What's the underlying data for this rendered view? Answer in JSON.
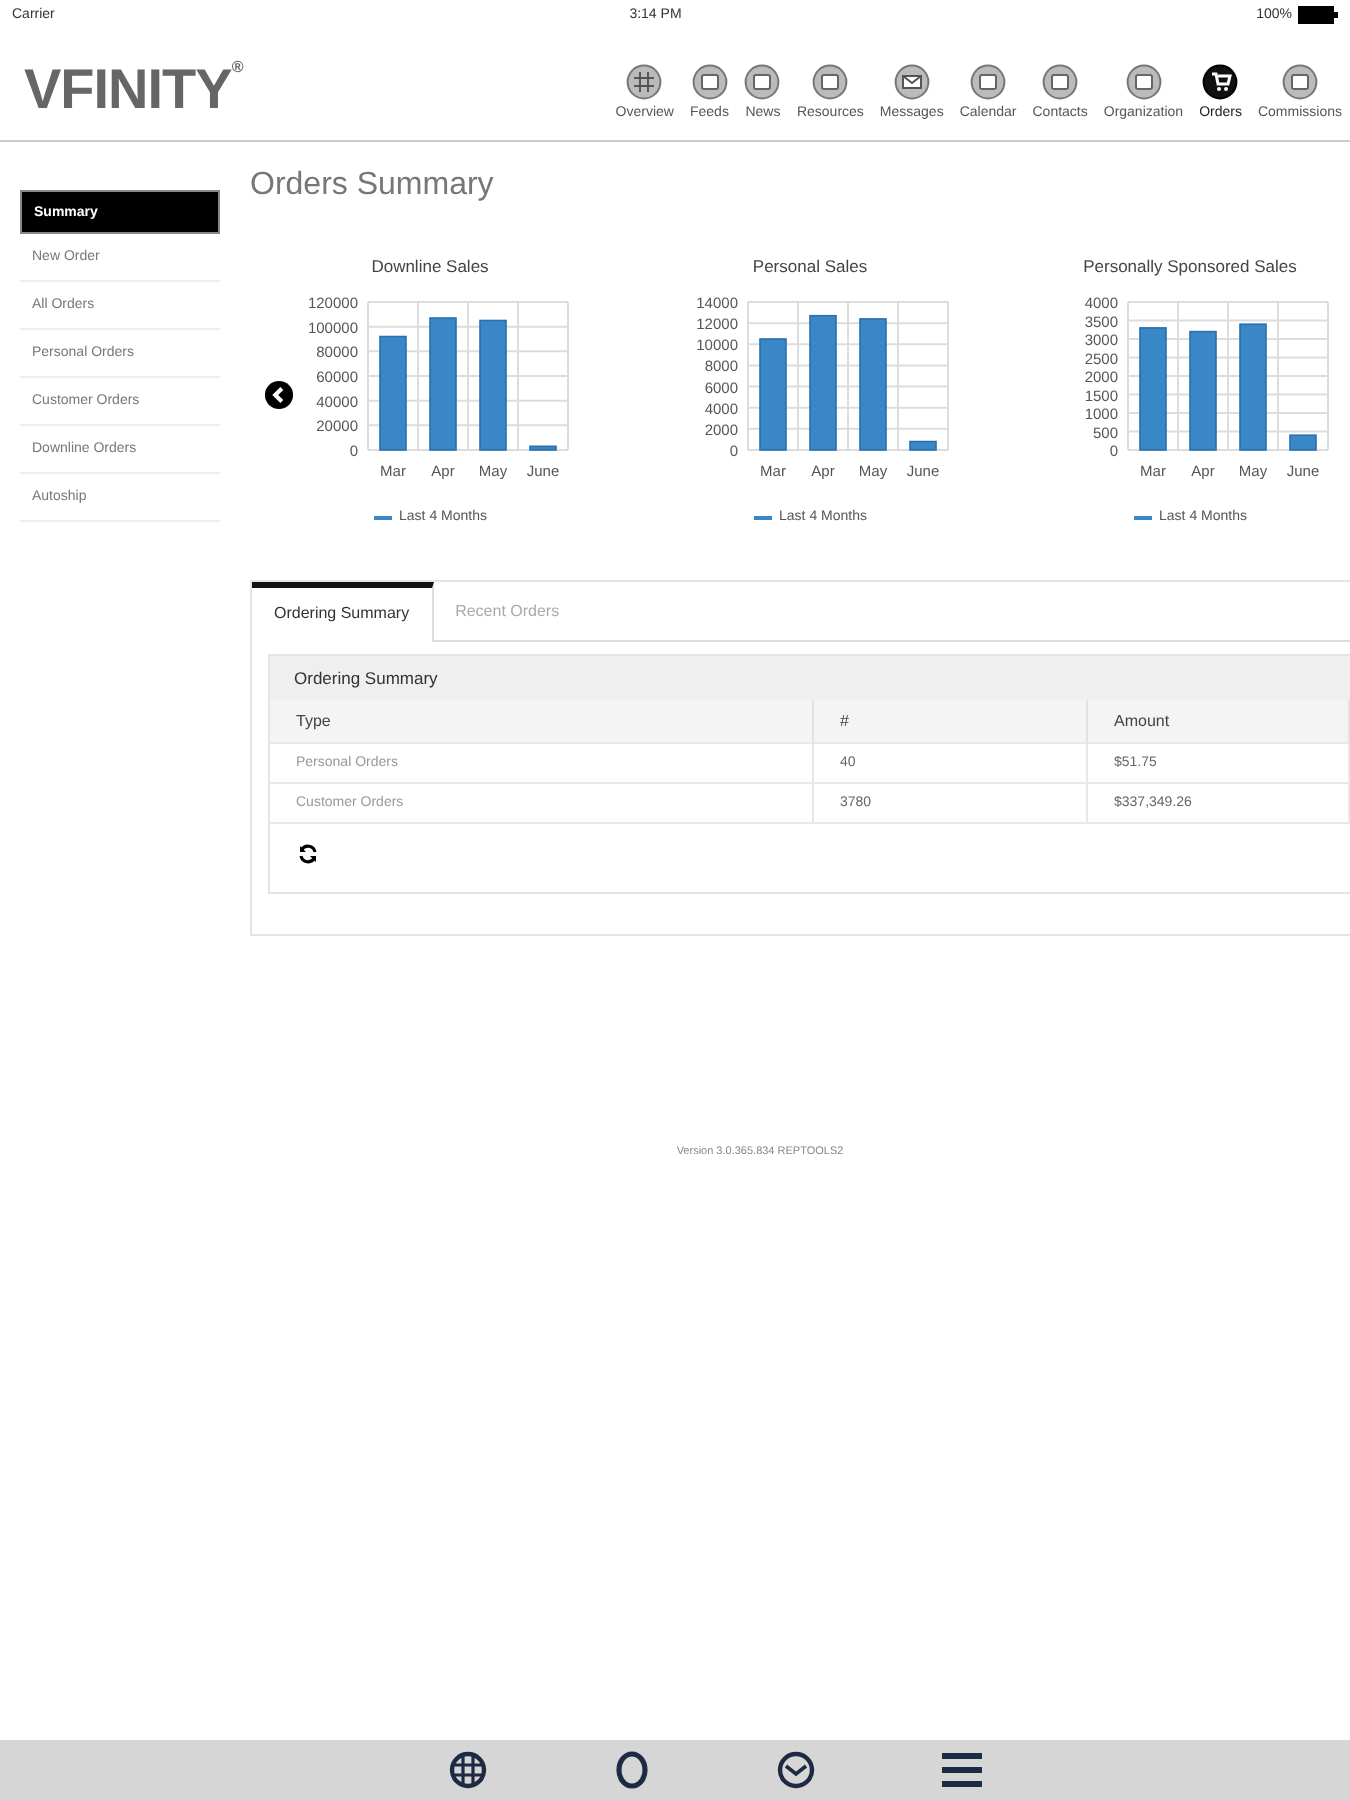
{
  "status_bar": {
    "carrier": "Carrier",
    "time": "3:14 PM",
    "battery": "100%"
  },
  "logo": "VFINITY",
  "logo_mark": "®",
  "nav": [
    {
      "label": "Overview",
      "selected": false
    },
    {
      "label": "Feeds",
      "selected": false
    },
    {
      "label": "News",
      "selected": false
    },
    {
      "label": "Resources",
      "selected": false
    },
    {
      "label": "Messages",
      "selected": false
    },
    {
      "label": "Calendar",
      "selected": false
    },
    {
      "label": "Contacts",
      "selected": false
    },
    {
      "label": "Organization",
      "selected": false
    },
    {
      "label": "Orders",
      "selected": true
    },
    {
      "label": "Commissions",
      "selected": false
    }
  ],
  "sidebar": {
    "items": [
      {
        "label": "Summary",
        "selected": true
      },
      {
        "label": "New Order",
        "selected": false
      },
      {
        "label": "All Orders",
        "selected": false
      },
      {
        "label": "Personal Orders",
        "selected": false
      },
      {
        "label": "Customer Orders",
        "selected": false
      },
      {
        "label": "Downline Orders",
        "selected": false
      },
      {
        "label": "Autoship",
        "selected": false
      }
    ]
  },
  "page_title": "Orders Summary",
  "charts": [
    {
      "chart_data": {
        "type": "bar",
        "title": "Downline Sales",
        "categories": [
          "Mar",
          "Apr",
          "May",
          "June"
        ],
        "series": [
          {
            "name": "Last 4 Months",
            "color": "#3a87c8",
            "values": [
              92000,
              107000,
              105000,
              3000
            ]
          }
        ],
        "ylim": [
          0,
          120000
        ],
        "yticks": [
          0,
          20000,
          40000,
          60000,
          80000,
          100000,
          120000
        ],
        "grid": true
      }
    },
    {
      "chart_data": {
        "type": "bar",
        "title": "Personal Sales",
        "categories": [
          "Mar",
          "Apr",
          "May",
          "June"
        ],
        "series": [
          {
            "name": "Last 4 Months",
            "color": "#3a87c8",
            "values": [
              10500,
              12700,
              12400,
              800
            ]
          }
        ],
        "ylim": [
          0,
          14000
        ],
        "yticks": [
          0,
          2000,
          4000,
          6000,
          8000,
          10000,
          12000,
          14000
        ],
        "grid": true
      }
    },
    {
      "chart_data": {
        "type": "bar",
        "title": "Personally Sponsored Sales",
        "categories": [
          "Mar",
          "Apr",
          "May",
          "June"
        ],
        "series": [
          {
            "name": "Last 4 Months",
            "color": "#3a87c8",
            "values": [
              3300,
              3200,
              3400,
              400
            ]
          }
        ],
        "ylim": [
          0,
          4000
        ],
        "yticks": [
          0,
          500,
          1000,
          1500,
          2000,
          2500,
          3000,
          3500,
          4000
        ],
        "grid": true
      }
    }
  ],
  "tabs": [
    {
      "label": "Ordering Summary",
      "selected": true
    },
    {
      "label": "Recent Orders",
      "selected": false
    }
  ],
  "summary": {
    "title": "Ordering Summary",
    "columns": [
      "Type",
      "#",
      "Amount"
    ],
    "rows": [
      [
        "Personal Orders",
        "40",
        "$51.75"
      ],
      [
        "Customer Orders",
        "3780",
        "$337,349.26"
      ]
    ]
  },
  "version": "Version 3.0.365.834 REPTOOLS2"
}
